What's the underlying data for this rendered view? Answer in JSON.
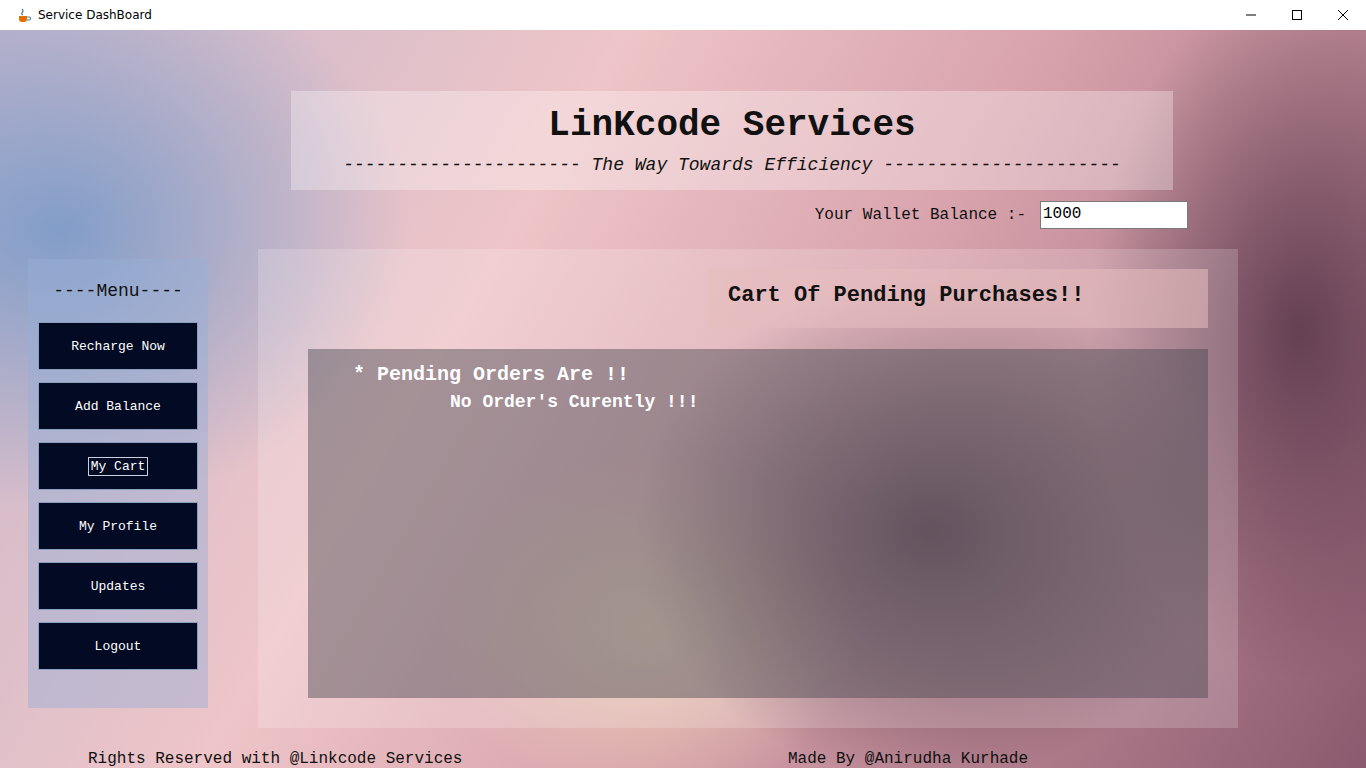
{
  "window": {
    "title": "Service DashBoard"
  },
  "header": {
    "title": "LinKcode Services",
    "tagline": "---------------------- The Way Towards Efficiency ----------------------"
  },
  "wallet": {
    "label": "Your Wallet Balance :-",
    "value": "1000"
  },
  "menu": {
    "title": "----Menu----",
    "items": [
      {
        "label": "Recharge Now",
        "focused": false
      },
      {
        "label": "Add Balance",
        "focused": false
      },
      {
        "label": "My Cart",
        "focused": true
      },
      {
        "label": "My Profile",
        "focused": false
      },
      {
        "label": "Updates",
        "focused": false
      },
      {
        "label": "Logout",
        "focused": false
      }
    ]
  },
  "cart": {
    "title": "Cart Of Pending Purchases!!",
    "heading": "* Pending Orders Are !!",
    "message": "No Order's Curently !!!"
  },
  "footer": {
    "rights": "Rights Reserved with @Linkcode Services",
    "author": "Made By @Anirudha Kurhade"
  }
}
